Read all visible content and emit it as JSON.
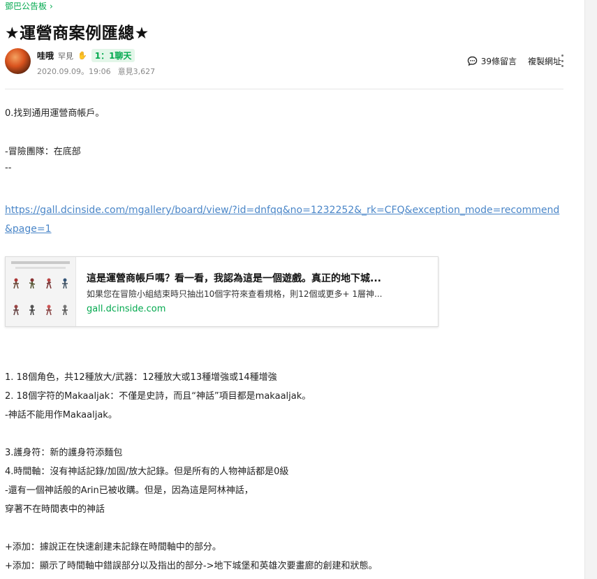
{
  "breadcrumb": {
    "label": "鄧巴公告板",
    "chevron": "chevron-right-icon"
  },
  "post": {
    "title": "★運營商案例匯總★",
    "author": {
      "name": "哇哦",
      "level": "罕見",
      "badge_icon": "hand-icon",
      "chat_badge": "1：1聊天"
    },
    "date": "2020.09.09。19:06",
    "views": "意見3,627",
    "comments": "39條留言",
    "copy_url": "複製網址"
  },
  "body": {
    "line1": "0.找到通用運營商帳戶。",
    "line2": "-冒險團隊：在底部",
    "line3": "--",
    "link": "https://gall.dcinside.com/mgallery/board/view/?id=dnfqq&no=1232252&_rk=CFQ&exception_mode=recommend&page=1",
    "card": {
      "title": "這是運營商帳戶嗎？看一看，我認為這是一個遊戲。真正的地下城...",
      "desc": "如果您在冒險小組結束時只抽出10個字符來查看規格，則12個或更多+ 1層神...",
      "domain": "gall.dcinside.com"
    },
    "item1": "1. 18個角色，共12種放大/武器：12種放大或13種增強或14種增強",
    "item2": "2. 18個字符的Makaaljak：不僅是史詩，而且“神話”項目都是makaaljak。",
    "item2b": "-神話不能用作Makaaljak。",
    "item3": "3.護身符：新的護身符添麵包",
    "item4": "4.時間軸：沒有神話記錄/加固/放大記錄。但是所有的人物神話都是0級",
    "item4b": "-還有一個神話般的Arin已被收購。但是，因為這是阿林神話，",
    "item4c": "穿著不在時間表中的神話",
    "add1": "+添加：據說正在快速創建未記錄在時間軸中的部分。",
    "add2": "+添加：顯示了時間軸中錯誤部分以及指出的部分->地下城堡和英雄次要畫廊的創建和狀態。"
  },
  "colors": {
    "accent": "#03a94f",
    "link": "#4a86c8"
  }
}
